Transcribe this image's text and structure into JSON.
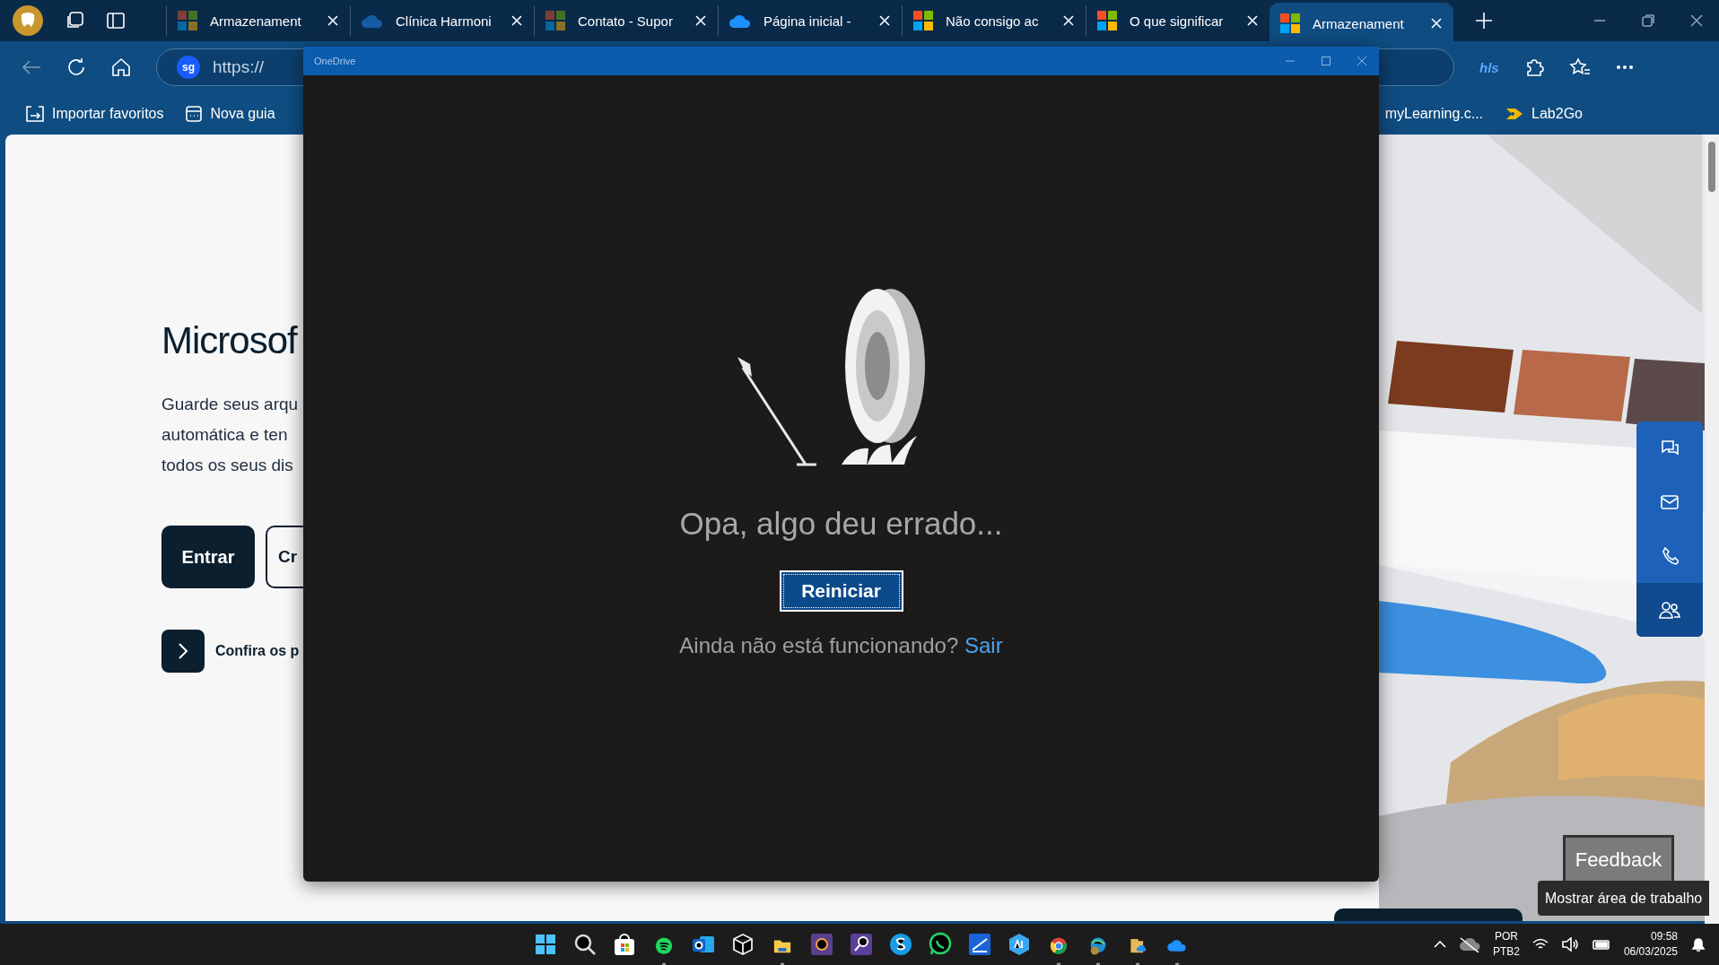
{
  "browser": {
    "tabs": [
      {
        "title": "Armazenament",
        "kind": "microsoft",
        "sleeping": true,
        "selected": false
      },
      {
        "title": "Clínica Harmoni",
        "kind": "cloud",
        "sleeping": true,
        "selected": false
      },
      {
        "title": "Contato - Supor",
        "kind": "microsoft",
        "sleeping": true,
        "selected": false
      },
      {
        "title": "Página inicial -",
        "kind": "cloud",
        "sleeping": false,
        "selected": false
      },
      {
        "title": "Não consigo ac",
        "kind": "microsoft",
        "sleeping": false,
        "selected": false
      },
      {
        "title": "O que significar",
        "kind": "microsoft",
        "sleeping": false,
        "selected": false
      },
      {
        "title": "Armazenament",
        "kind": "microsoft",
        "sleeping": false,
        "selected": true
      }
    ],
    "address": "https://",
    "search_badge": "sg",
    "extension_label": "hls",
    "bookmarks": [
      {
        "label": "Importar favoritos"
      },
      {
        "label": "Nova guia"
      },
      {
        "label": "myLearning.c..."
      },
      {
        "label": "Lab2Go"
      }
    ]
  },
  "page": {
    "heading": "Microsof",
    "intro": [
      "Guarde seus arqu",
      "automática e ten",
      "todos os seus dis"
    ],
    "primary_button": "Entrar",
    "secondary_button": "Cr",
    "link": "Confira os p",
    "contact_bar": [
      {
        "kind": "chat",
        "selected": false
      },
      {
        "kind": "mail",
        "selected": false
      },
      {
        "kind": "phone",
        "selected": false
      },
      {
        "kind": "people",
        "selected": true
      }
    ],
    "feedback": "Feedback"
  },
  "onedrive_window": {
    "title": "OneDrive",
    "message": "Opa, algo deu errado...",
    "button": "Reiniciar",
    "help_text": "Ainda não está funcionando?",
    "help_link": "Sair"
  },
  "tooltip": "Mostrar área de trabalho",
  "taskbar": {
    "apps": [
      {
        "running": false
      },
      {
        "running": false
      },
      {
        "running": false
      },
      {
        "running": true
      },
      {
        "running": false
      },
      {
        "running": false
      },
      {
        "running": true
      },
      {
        "running": false
      },
      {
        "running": false
      },
      {
        "running": false
      },
      {
        "running": false
      },
      {
        "running": false
      },
      {
        "running": false
      },
      {
        "running": true
      },
      {
        "running": true
      },
      {
        "running": true
      },
      {
        "running": true
      }
    ],
    "language": "POR",
    "layout": "PTB2",
    "time": "09:58",
    "date": "06/03/2025"
  }
}
